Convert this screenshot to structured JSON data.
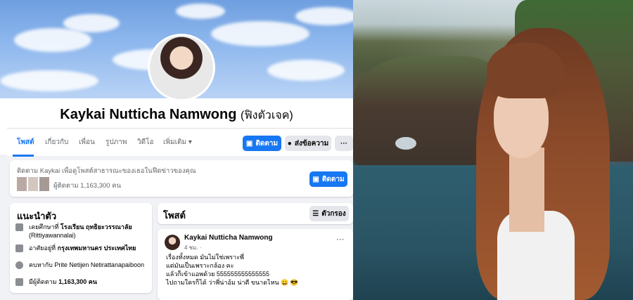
{
  "profile": {
    "name": "Kaykai Nutticha Namwong",
    "alt_name": "(ฟิงตัวเจค)"
  },
  "nav": {
    "tabs": [
      "โพสต์",
      "เกี่ยวกับ",
      "เพื่อน",
      "รูปภาพ",
      "วิดีโอ",
      "เพิ่มเติม"
    ],
    "follow_label": "ติดตาม",
    "message_label": "ส่งข้อความ",
    "more_label": "···"
  },
  "follow_card": {
    "prompt": "ติดตาม Kaykai เพื่อดูโพสต์สาธารณะของเธอในฟีดข่าวของคุณ",
    "followers": "ผู้ติดตาม 1,163,300 คน",
    "follow_label": "ติดตาม"
  },
  "intro": {
    "title": "แนะนำตัว",
    "rows": [
      {
        "prefix": "เคยศึกษาที่",
        "bold": "โรงเรียน ฤทธิยะวรรณาลัย",
        "suffix": "(Rittiyawannalai)"
      },
      {
        "prefix": "อาศัยอยู่ที่",
        "bold": "กรุงเทพมหานคร ประเทศไทย",
        "suffix": ""
      },
      {
        "prefix": "คบหากับ",
        "bold": "Prite Netijen Netirattanapaiboon",
        "suffix": ""
      },
      {
        "prefix": "มีผู้ติดตาม",
        "bold": "1,163,300 คน",
        "suffix": ""
      }
    ]
  },
  "posts": {
    "title": "โพสต์",
    "filter_label": "ตัวกรอง",
    "post": {
      "author": "Kaykai Nutticha Namwong",
      "time": "4 ชม. ·",
      "lines": [
        "เรื่องทั้งหมด มันไม่ใช่เพราะพี่",
        "แต่มันเป็นเพราะกล้อง คะ",
        "แล้วก็เข้าแอพด้วย 555555555555555",
        "ไปถามใครก็ได้ ว่าพี่น่าอ้ม น่าตี ขนาดไหน 😀 😎"
      ]
    }
  },
  "colors": {
    "accent": "#1877f2",
    "background": "#f0f2f5"
  }
}
